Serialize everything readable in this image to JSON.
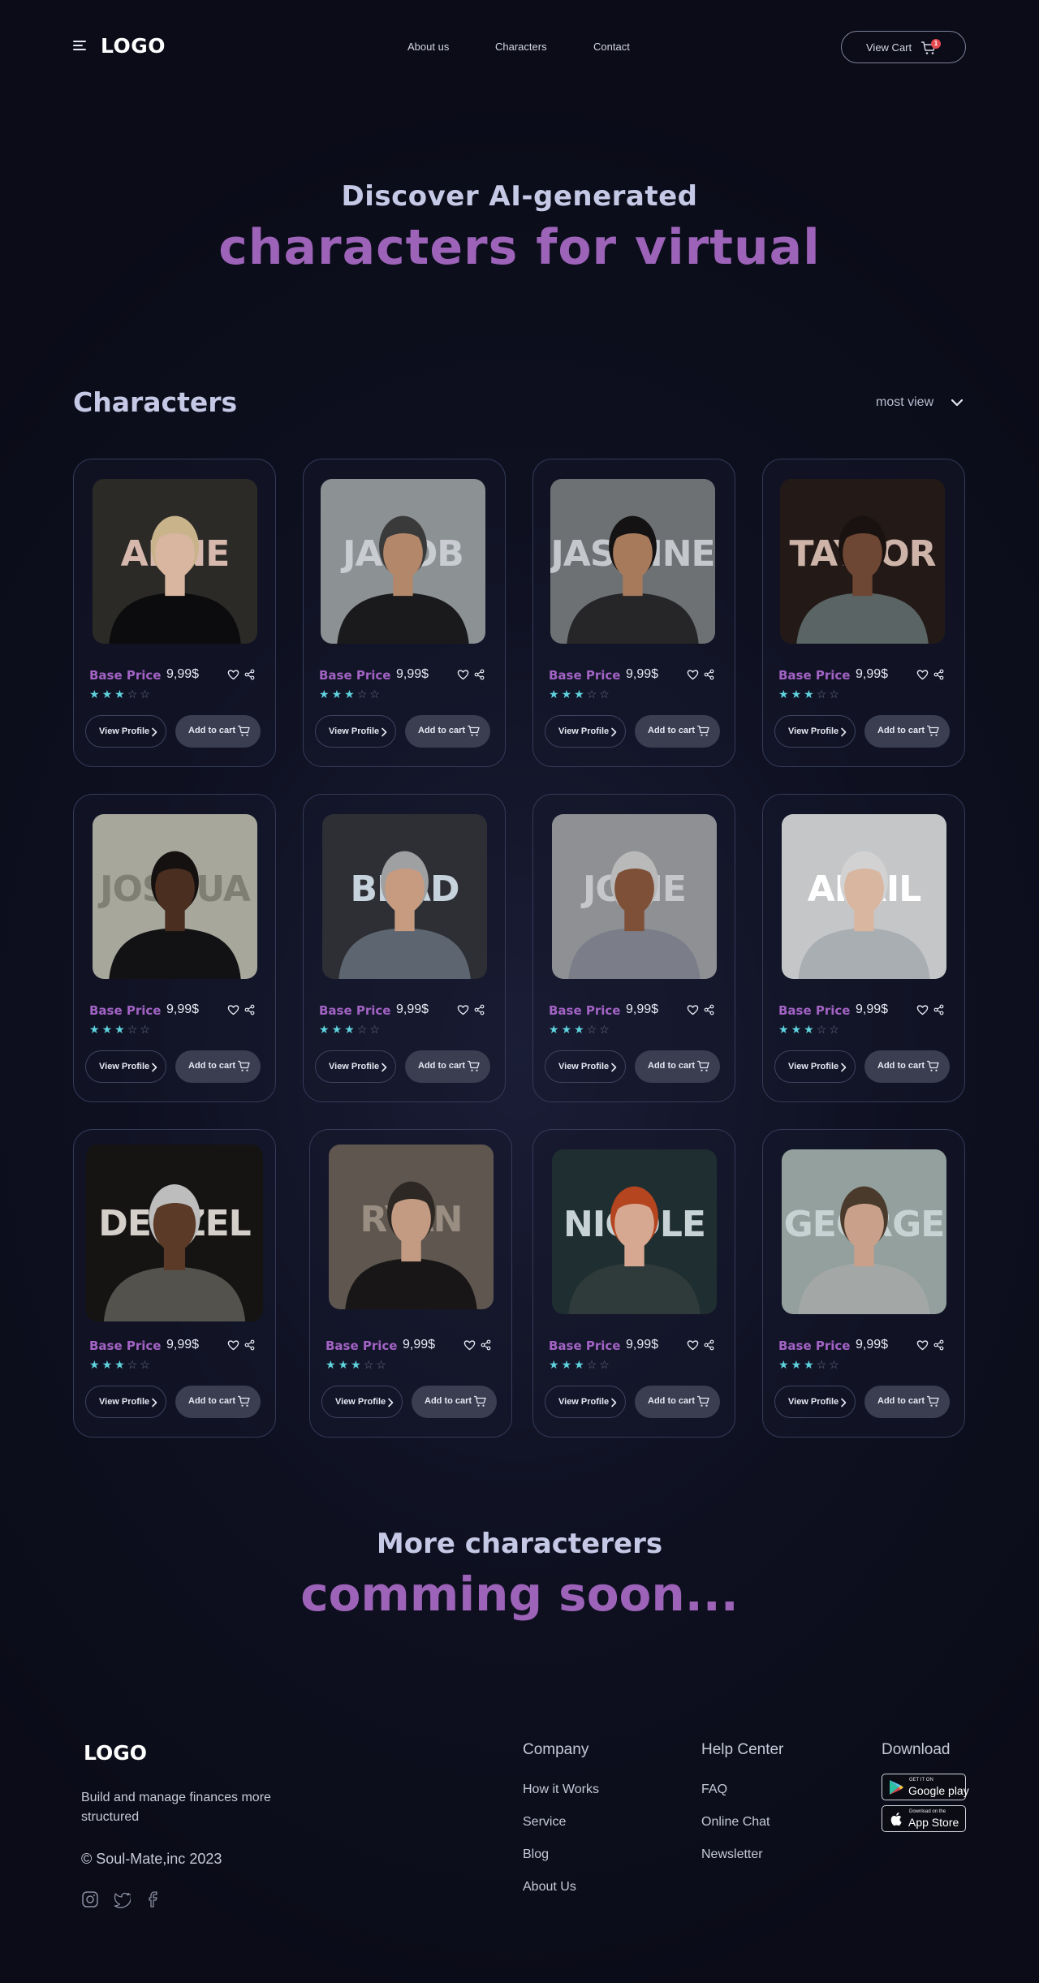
{
  "header": {
    "logo": "LOGO",
    "nav": [
      "About us",
      "Characters",
      "Contact"
    ],
    "cart_label": "View Cart",
    "cart_count": "1"
  },
  "hero": {
    "subtitle": "Discover AI-generated",
    "title": "characters for virtual"
  },
  "characters_section": {
    "title": "Characters",
    "sort_label": "most view"
  },
  "cards": [
    {
      "name": "ANNE",
      "price_label": "Base Price",
      "price": "9,99$",
      "rating": 3,
      "view_label": "View Profile",
      "cart_label": "Add to cart",
      "bg": "#2b2a26",
      "name_color": "#d7b8ad",
      "skin": "#d8b6a0",
      "hair": "#c8b38a",
      "shirt": "#0c0c0e"
    },
    {
      "name": "JACOB",
      "price_label": "Base Price",
      "price": "9,99$",
      "rating": 3,
      "view_label": "View Profile",
      "cart_label": "Add to cart",
      "bg": "#8c9194",
      "name_color": "#c9ccd0",
      "skin": "#b3876a",
      "hair": "#3a3a3a",
      "shirt": "#1a1a1c"
    },
    {
      "name": "JASMINE",
      "price_label": "Base Price",
      "price": "9,99$",
      "rating": 3,
      "view_label": "View Profile",
      "cart_label": "Add to cart",
      "bg": "#6e7174",
      "name_color": "#c4c8cc",
      "skin": "#a77a5b",
      "hair": "#141212",
      "shirt": "#262628"
    },
    {
      "name": "TAYLOR",
      "price_label": "Base Price",
      "price": "9,99$",
      "rating": 3,
      "view_label": "View Profile",
      "cart_label": "Add to cart",
      "bg": "#231a18",
      "name_color": "#cdb3a8",
      "skin": "#6e4634",
      "hair": "#1a1210",
      "shirt": "#5a6464"
    },
    {
      "name": "JOSHUA",
      "price_label": "Base Price",
      "price": "9,99$",
      "rating": 3,
      "view_label": "View Profile",
      "cart_label": "Add to cart",
      "bg": "#a7a79c",
      "name_color": "#807f73",
      "skin": "#4a2e20",
      "hair": "#151110",
      "shirt": "#121214"
    },
    {
      "name": "BRAD",
      "price_label": "Base Price",
      "price": "9,99$",
      "rating": 3,
      "view_label": "View Profile",
      "cart_label": "Add to cart",
      "bg": "#2d2f34",
      "name_color": "#c7d3dc",
      "skin": "#c79b80",
      "hair": "#9ea0a2",
      "shirt": "#5d6570"
    },
    {
      "name": "JOSIE",
      "price_label": "Base Price",
      "price": "9,99$",
      "rating": 3,
      "view_label": "View Profile",
      "cart_label": "Add to cart",
      "bg": "#8e9094",
      "name_color": "#c5c7cb",
      "skin": "#7e5038",
      "hair": "#b9b9b9",
      "shirt": "#7b7e88"
    },
    {
      "name": "APRIL",
      "price_label": "Base Price",
      "price": "9,99$",
      "rating": 3,
      "view_label": "View Profile",
      "cart_label": "Add to cart",
      "bg": "#c4c6c8",
      "name_color": "#ffffff",
      "skin": "#d9b6a0",
      "hair": "#d2d2d2",
      "shirt": "#a9aeb3"
    },
    {
      "name": "DENZEL",
      "price_label": "Base Price",
      "price": "9,99$",
      "rating": 3,
      "view_label": "View Profile",
      "cart_label": "Add to cart",
      "bg": "#151413",
      "name_color": "#d5cfca",
      "skin": "#5c3a28",
      "hair": "#bdbdbd",
      "shirt": "#54524c"
    },
    {
      "name": "RYAN",
      "price_label": "Base Price",
      "price": "9,99$",
      "rating": 3,
      "view_label": "View Profile",
      "cart_label": "Add to cart",
      "bg": "#5e564f",
      "name_color": "#9a8e82",
      "skin": "#c39a82",
      "hair": "#2e2824",
      "shirt": "#181616"
    },
    {
      "name": "NICOLE",
      "price_label": "Base Price",
      "price": "9,99$",
      "rating": 3,
      "view_label": "View Profile",
      "cart_label": "Add to cart",
      "bg": "#1f2e30",
      "name_color": "#c7d2d4",
      "skin": "#d6a892",
      "hair": "#b4451f",
      "shirt": "#2f3a3a"
    },
    {
      "name": "GEORGE",
      "price_label": "Base Price",
      "price": "9,99$",
      "rating": 3,
      "view_label": "View Profile",
      "cart_label": "Add to cart",
      "bg": "#93a09e",
      "name_color": "#c7d3d2",
      "skin": "#c9a08a",
      "hair": "#4a3a2c",
      "shirt": "#a3a7a6"
    }
  ],
  "more": {
    "subtitle": "More characterers",
    "title": "comming soon..."
  },
  "footer": {
    "logo": "LOGO",
    "tagline": "Build and manage finances more structured",
    "copyright": "© Soul-Mate,inc 2023",
    "company": {
      "title": "Company",
      "links": [
        "How it Works",
        "Service",
        "Blog",
        "About Us"
      ]
    },
    "help": {
      "title": "Help Center",
      "links": [
        "FAQ",
        "Online Chat",
        "Newsletter"
      ]
    },
    "download": {
      "title": "Download",
      "google_top": "GET IT ON",
      "google_main": "Google play",
      "apple_top": "Download on the",
      "apple_main": "App Store"
    }
  },
  "colors": {
    "accent": "#9c63b8",
    "star": "#5fd3de",
    "background": "#0e1020"
  }
}
